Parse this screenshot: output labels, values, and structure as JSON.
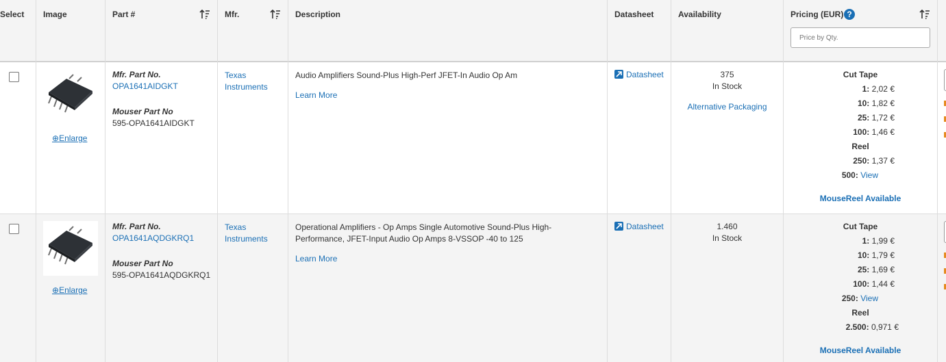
{
  "headers": {
    "select": "Select",
    "image": "Image",
    "part": "Part #",
    "mfr": "Mfr.",
    "description": "Description",
    "datasheet": "Datasheet",
    "availability": "Availability",
    "pricing": "Pricing (EUR)",
    "price_placeholder": "Price by Qty."
  },
  "rows": [
    {
      "mfr_label": "Mfr. Part No.",
      "mfr_part": "OPA1641AIDGKT",
      "mouser_label": "Mouser Part No",
      "mouser_part": "595-OPA1641AIDGKT",
      "enlarge": "Enlarge",
      "mfr_line1": "Texas",
      "mfr_line2": "Instruments",
      "desc_line1": "Audio Amplifiers Sound-Plus High-Perf JFET-In Audio Op Am",
      "desc_line2": "",
      "learn_more": "Learn More",
      "datasheet": "Datasheet",
      "avail_qty": "375",
      "avail_status": "In Stock",
      "alt_packaging": "Alternative Packaging",
      "prices": [
        {
          "type": "title",
          "text": "Cut Tape"
        },
        {
          "qty": "1:",
          "price": "2,02 €"
        },
        {
          "qty": "10:",
          "price": "1,82 €"
        },
        {
          "qty": "25:",
          "price": "1,72 €"
        },
        {
          "qty": "100:",
          "price": "1,46 €"
        },
        {
          "type": "title",
          "text": "Reel"
        },
        {
          "qty": "250:",
          "price": "1,37 €"
        },
        {
          "qty": "500:",
          "price": "View",
          "link": true
        }
      ],
      "mousereel": "MouseReel Available"
    },
    {
      "mfr_label": "Mfr. Part No.",
      "mfr_part": "OPA1641AQDGKRQ1",
      "mouser_label": "Mouser Part No",
      "mouser_part": "595-OPA1641AQDGKRQ1",
      "enlarge": "Enlarge",
      "mfr_line1": "Texas",
      "mfr_line2": "Instruments",
      "desc_line1": "Operational Amplifiers - Op Amps Single Automotive Sound-Plus High-",
      "desc_line2": "Performance, JFET-Input Audio Op Amps 8-VSSOP -40 to 125",
      "learn_more": "Learn More",
      "datasheet": "Datasheet",
      "avail_qty": "1.460",
      "avail_status": "In Stock",
      "alt_packaging": "",
      "prices": [
        {
          "type": "title",
          "text": "Cut Tape"
        },
        {
          "qty": "1:",
          "price": "1,99 €"
        },
        {
          "qty": "10:",
          "price": "1,79 €"
        },
        {
          "qty": "25:",
          "price": "1,69 €"
        },
        {
          "qty": "100:",
          "price": "1,44 €"
        },
        {
          "qty": "250:",
          "price": "View",
          "link": true
        },
        {
          "type": "title",
          "text": "Reel"
        },
        {
          "qty": "2.500:",
          "price": "0,971 €"
        }
      ],
      "mousereel": "MouseReel Available"
    }
  ]
}
